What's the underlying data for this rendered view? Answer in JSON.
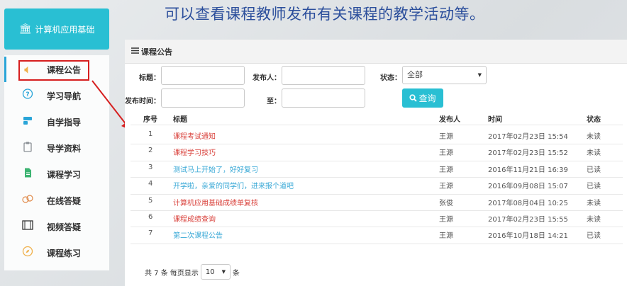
{
  "headline": "可以查看课程教师发布有关课程的教学活动等。",
  "course": {
    "title": "计算机应用基础"
  },
  "sidebar": {
    "items": [
      {
        "label": "课程公告",
        "icon": "speaker-icon",
        "active": true
      },
      {
        "label": "学习导航",
        "icon": "help-bubble-icon"
      },
      {
        "label": "自学指导",
        "icon": "guide-icon"
      },
      {
        "label": "导学资料",
        "icon": "clipboard-icon"
      },
      {
        "label": "课程学习",
        "icon": "document-icon"
      },
      {
        "label": "在线答疑",
        "icon": "chat-icon"
      },
      {
        "label": "视频答疑",
        "icon": "film-icon"
      },
      {
        "label": "课程练习",
        "icon": "compass-icon"
      }
    ]
  },
  "panel": {
    "title": "课程公告",
    "filters": {
      "title_label": "标题：",
      "publisher_label": "发布人：",
      "status_label": "状态：",
      "status_value": "全部",
      "time_label": "发布时间：",
      "to_label": "至：",
      "title_value": "",
      "publisher_value": "",
      "time_from": "",
      "time_to": "",
      "query_label": "查询"
    },
    "table": {
      "headers": [
        "序号",
        "标题",
        "发布人",
        "时间",
        "状态"
      ],
      "rows": [
        {
          "no": "1",
          "title": "课程考试通知",
          "publisher": "王源",
          "time": "2017年02月23日 15:54",
          "status": "未读"
        },
        {
          "no": "2",
          "title": "课程学习技巧",
          "publisher": "王源",
          "time": "2017年02月23日 15:52",
          "status": "未读"
        },
        {
          "no": "3",
          "title": "测试马上开始了，好好复习",
          "publisher": "王源",
          "time": "2016年11月21日 16:39",
          "status": "已读"
        },
        {
          "no": "4",
          "title": "开学啦，亲爱的同学们，进来报个道吧",
          "publisher": "王源",
          "time": "2016年09月08日 15:07",
          "status": "已读"
        },
        {
          "no": "5",
          "title": "计算机应用基础成绩单复核",
          "publisher": "张俊",
          "time": "2017年08月04日 10:25",
          "status": "未读"
        },
        {
          "no": "6",
          "title": "课程成绩查询",
          "publisher": "王源",
          "time": "2017年02月23日 15:55",
          "status": "未读"
        },
        {
          "no": "7",
          "title": "第二次课程公告",
          "publisher": "王源",
          "time": "2016年10月18日 14:21",
          "status": "已读"
        }
      ]
    },
    "pager": {
      "prefix": "共 7 条 每页显示",
      "page_size": "10",
      "suffix": "条"
    }
  },
  "colors": {
    "accent": "#29bfd3",
    "unread_title": "#d9413b",
    "read_title": "#38a8d6",
    "annotation": "#d61f1f",
    "headline": "#2c4f9c"
  }
}
